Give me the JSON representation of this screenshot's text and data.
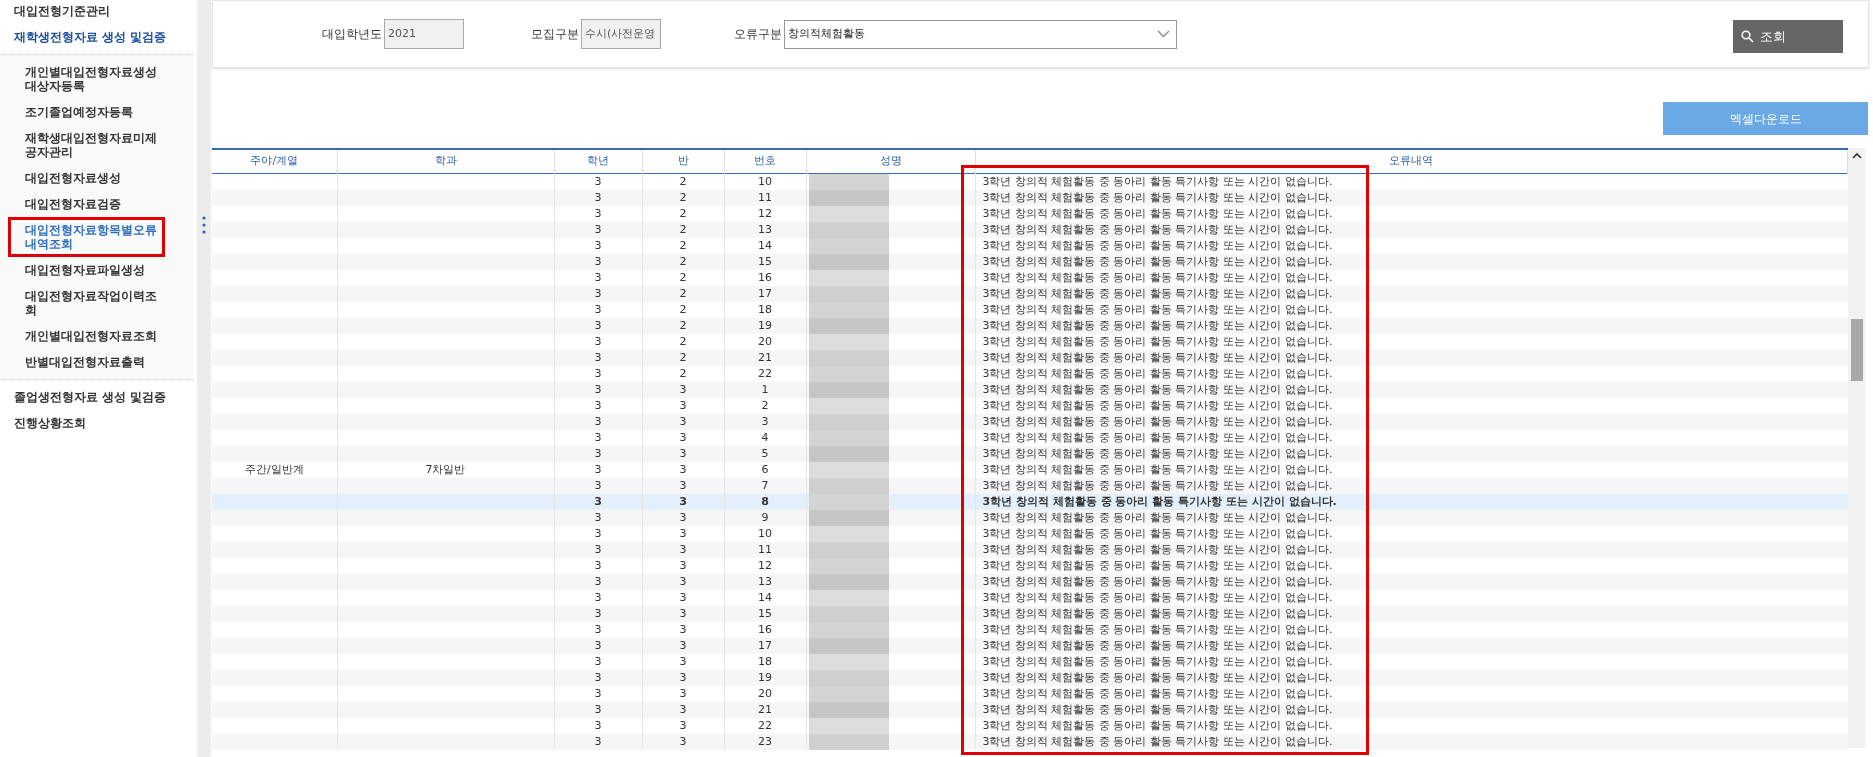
{
  "sidebar": {
    "items": [
      {
        "label": "대입전형기준관리",
        "selected": false
      },
      {
        "label": "재학생전형자료 생성 및검증",
        "selected": true,
        "children": [
          {
            "label": "개인별대입전형자료생성대상자등록",
            "selected": false
          },
          {
            "label": "조기졸업예정자등록",
            "selected": false
          },
          {
            "label": "재학생대입전형자료미제공자관리",
            "selected": false
          },
          {
            "label": "대입전형자료생성",
            "selected": false
          },
          {
            "label": "대입전형자료검증",
            "selected": false
          },
          {
            "label": "대입전형자료항목별오류내역조회",
            "selected": true,
            "framed": true
          },
          {
            "label": "대입전형자료파일생성",
            "selected": false
          },
          {
            "label": "대입전형자료작업이력조회",
            "selected": false
          },
          {
            "label": "개인별대입전형자료조회",
            "selected": false
          },
          {
            "label": "반별대입전형자료출력",
            "selected": false
          }
        ]
      },
      {
        "label": "졸업생전형자료 생성 및검증",
        "selected": false
      },
      {
        "label": "진행상황조회",
        "selected": false
      }
    ]
  },
  "filters": [
    {
      "kind": "input",
      "label": "대입학년도",
      "value": "2021",
      "disabled": true
    },
    {
      "kind": "input",
      "label": "모집구분",
      "value": "수시(사전운영",
      "disabled": true
    },
    {
      "kind": "select",
      "label": "오류구분",
      "value": "창의적체험활동",
      "disabled": false
    }
  ],
  "search_button": "조회",
  "excel_button": "엑셀다운로드",
  "table": {
    "columns": [
      {
        "label": "주야/계열"
      },
      {
        "label": "학과"
      },
      {
        "label": "학년"
      },
      {
        "label": "반"
      },
      {
        "label": "번호"
      },
      {
        "label": "성명"
      },
      {
        "label": "오류내역"
      }
    ],
    "error_column_framed": true,
    "rows": [
      {
        "column_1": "",
        "column_2": "",
        "grade": "3",
        "class": "2",
        "number": "10",
        "error": "3학년 창의적 체험활동 중 동아리 활동 특기사항 또는 시간이 없습니다.",
        "selected": false
      },
      {
        "column_1": "",
        "column_2": "",
        "grade": "3",
        "class": "2",
        "number": "11",
        "error": "3학년 창의적 체험활동 중 동아리 활동 특기사항 또는 시간이 없습니다.",
        "selected": false
      },
      {
        "column_1": "",
        "column_2": "",
        "grade": "3",
        "class": "2",
        "number": "12",
        "error": "3학년 창의적 체험활동 중 동아리 활동 특기사항 또는 시간이 없습니다.",
        "selected": false
      },
      {
        "column_1": "",
        "column_2": "",
        "grade": "3",
        "class": "2",
        "number": "13",
        "error": "3학년 창의적 체험활동 중 동아리 활동 특기사항 또는 시간이 없습니다.",
        "selected": false
      },
      {
        "column_1": "",
        "column_2": "",
        "grade": "3",
        "class": "2",
        "number": "14",
        "error": "3학년 창의적 체험활동 중 동아리 활동 특기사항 또는 시간이 없습니다.",
        "selected": false
      },
      {
        "column_1": "",
        "column_2": "",
        "grade": "3",
        "class": "2",
        "number": "15",
        "error": "3학년 창의적 체험활동 중 동아리 활동 특기사항 또는 시간이 없습니다.",
        "selected": false
      },
      {
        "column_1": "",
        "column_2": "",
        "grade": "3",
        "class": "2",
        "number": "16",
        "error": "3학년 창의적 체험활동 중 동아리 활동 특기사항 또는 시간이 없습니다.",
        "selected": false
      },
      {
        "column_1": "",
        "column_2": "",
        "grade": "3",
        "class": "2",
        "number": "17",
        "error": "3학년 창의적 체험활동 중 동아리 활동 특기사항 또는 시간이 없습니다.",
        "selected": false
      },
      {
        "column_1": "",
        "column_2": "",
        "grade": "3",
        "class": "2",
        "number": "18",
        "error": "3학년 창의적 체험활동 중 동아리 활동 특기사항 또는 시간이 없습니다.",
        "selected": false
      },
      {
        "column_1": "",
        "column_2": "",
        "grade": "3",
        "class": "2",
        "number": "19",
        "error": "3학년 창의적 체험활동 중 동아리 활동 특기사항 또는 시간이 없습니다.",
        "selected": false
      },
      {
        "column_1": "",
        "column_2": "",
        "grade": "3",
        "class": "2",
        "number": "20",
        "error": "3학년 창의적 체험활동 중 동아리 활동 특기사항 또는 시간이 없습니다.",
        "selected": false
      },
      {
        "column_1": "",
        "column_2": "",
        "grade": "3",
        "class": "2",
        "number": "21",
        "error": "3학년 창의적 체험활동 중 동아리 활동 특기사항 또는 시간이 없습니다.",
        "selected": false
      },
      {
        "column_1": "",
        "column_2": "",
        "grade": "3",
        "class": "2",
        "number": "22",
        "error": "3학년 창의적 체험활동 중 동아리 활동 특기사항 또는 시간이 없습니다.",
        "selected": false
      },
      {
        "column_1": "",
        "column_2": "",
        "grade": "3",
        "class": "3",
        "number": "1",
        "error": "3학년 창의적 체험활동 중 동아리 활동 특기사항 또는 시간이 없습니다.",
        "selected": false
      },
      {
        "column_1": "",
        "column_2": "",
        "grade": "3",
        "class": "3",
        "number": "2",
        "error": "3학년 창의적 체험활동 중 동아리 활동 특기사항 또는 시간이 없습니다.",
        "selected": false
      },
      {
        "column_1": "",
        "column_2": "",
        "grade": "3",
        "class": "3",
        "number": "3",
        "error": "3학년 창의적 체험활동 중 동아리 활동 특기사항 또는 시간이 없습니다.",
        "selected": false
      },
      {
        "column_1": "",
        "column_2": "",
        "grade": "3",
        "class": "3",
        "number": "4",
        "error": "3학년 창의적 체험활동 중 동아리 활동 특기사항 또는 시간이 없습니다.",
        "selected": false
      },
      {
        "column_1": "",
        "column_2": "",
        "grade": "3",
        "class": "3",
        "number": "5",
        "error": "3학년 창의적 체험활동 중 동아리 활동 특기사항 또는 시간이 없습니다.",
        "selected": false
      },
      {
        "column_1": "주간/일반계",
        "column_2": "7차일반",
        "grade": "3",
        "class": "3",
        "number": "6",
        "error": "3학년 창의적 체험활동 중 동아리 활동 특기사항 또는 시간이 없습니다.",
        "selected": false
      },
      {
        "column_1": "",
        "column_2": "",
        "grade": "3",
        "class": "3",
        "number": "7",
        "error": "3학년 창의적 체험활동 중 동아리 활동 특기사항 또는 시간이 없습니다.",
        "selected": false
      },
      {
        "column_1": "",
        "column_2": "",
        "grade": "3",
        "class": "3",
        "number": "8",
        "error": "3학년 창의적 체험활동 중 동아리 활동 특기사항 또는 시간이 없습니다.",
        "selected": true
      },
      {
        "column_1": "",
        "column_2": "",
        "grade": "3",
        "class": "3",
        "number": "9",
        "error": "3학년 창의적 체험활동 중 동아리 활동 특기사항 또는 시간이 없습니다.",
        "selected": false
      },
      {
        "column_1": "",
        "column_2": "",
        "grade": "3",
        "class": "3",
        "number": "10",
        "error": "3학년 창의적 체험활동 중 동아리 활동 특기사항 또는 시간이 없습니다.",
        "selected": false
      },
      {
        "column_1": "",
        "column_2": "",
        "grade": "3",
        "class": "3",
        "number": "11",
        "error": "3학년 창의적 체험활동 중 동아리 활동 특기사항 또는 시간이 없습니다.",
        "selected": false
      },
      {
        "column_1": "",
        "column_2": "",
        "grade": "3",
        "class": "3",
        "number": "12",
        "error": "3학년 창의적 체험활동 중 동아리 활동 특기사항 또는 시간이 없습니다.",
        "selected": false
      },
      {
        "column_1": "",
        "column_2": "",
        "grade": "3",
        "class": "3",
        "number": "13",
        "error": "3학년 창의적 체험활동 중 동아리 활동 특기사항 또는 시간이 없습니다.",
        "selected": false
      },
      {
        "column_1": "",
        "column_2": "",
        "grade": "3",
        "class": "3",
        "number": "14",
        "error": "3학년 창의적 체험활동 중 동아리 활동 특기사항 또는 시간이 없습니다.",
        "selected": false
      },
      {
        "column_1": "",
        "column_2": "",
        "grade": "3",
        "class": "3",
        "number": "15",
        "error": "3학년 창의적 체험활동 중 동아리 활동 특기사항 또는 시간이 없습니다.",
        "selected": false
      },
      {
        "column_1": "",
        "column_2": "",
        "grade": "3",
        "class": "3",
        "number": "16",
        "error": "3학년 창의적 체험활동 중 동아리 활동 특기사항 또는 시간이 없습니다.",
        "selected": false
      },
      {
        "column_1": "",
        "column_2": "",
        "grade": "3",
        "class": "3",
        "number": "17",
        "error": "3학년 창의적 체험활동 중 동아리 활동 특기사항 또는 시간이 없습니다.",
        "selected": false
      },
      {
        "column_1": "",
        "column_2": "",
        "grade": "3",
        "class": "3",
        "number": "18",
        "error": "3학년 창의적 체험활동 중 동아리 활동 특기사항 또는 시간이 없습니다.",
        "selected": false
      },
      {
        "column_1": "",
        "column_2": "",
        "grade": "3",
        "class": "3",
        "number": "19",
        "error": "3학년 창의적 체험활동 중 동아리 활동 특기사항 또는 시간이 없습니다.",
        "selected": false
      },
      {
        "column_1": "",
        "column_2": "",
        "grade": "3",
        "class": "3",
        "number": "20",
        "error": "3학년 창의적 체험활동 중 동아리 활동 특기사항 또는 시간이 없습니다.",
        "selected": false
      },
      {
        "column_1": "",
        "column_2": "",
        "grade": "3",
        "class": "3",
        "number": "21",
        "error": "3학년 창의적 체험활동 중 동아리 활동 특기사항 또는 시간이 없습니다.",
        "selected": false
      },
      {
        "column_1": "",
        "column_2": "",
        "grade": "3",
        "class": "3",
        "number": "22",
        "error": "3학년 창의적 체험활동 중 동아리 활동 특기사항 또는 시간이 없습니다.",
        "selected": false
      },
      {
        "column_1": "",
        "column_2": "",
        "grade": "3",
        "class": "3",
        "number": "23",
        "error": "3학년 창의적 체험활동 중 동아리 활동 특기사항 또는 시간이 없습니다.",
        "selected": false
      }
    ]
  }
}
